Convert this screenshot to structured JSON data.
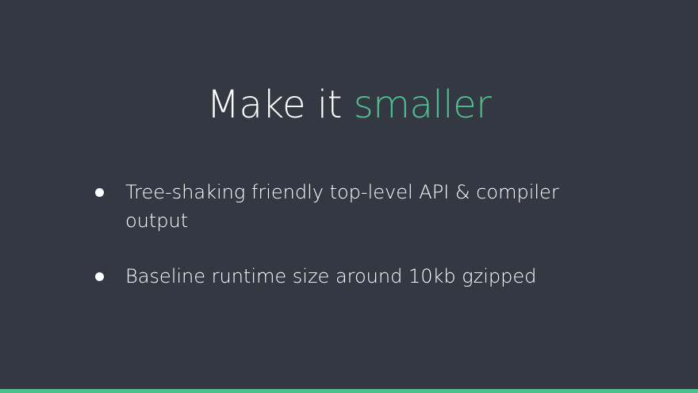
{
  "slide": {
    "title_main": "Make it ",
    "title_accent": "smaller",
    "bullets": [
      {
        "text": "Tree-shaking friendly top-level API & compiler output"
      },
      {
        "text": "Baseline runtime size around 10kb gzipped"
      }
    ]
  },
  "colors": {
    "background": "#333842",
    "accent": "#4fbf8c",
    "text": "#ffffff"
  }
}
